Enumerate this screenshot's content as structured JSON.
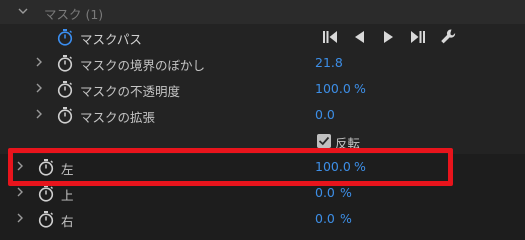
{
  "header": {
    "label": "マスク (1)"
  },
  "mask_path": {
    "label": "マスクパス"
  },
  "props": [
    {
      "label": "マスクの境界のぼかし",
      "value": "21.8",
      "unit": ""
    },
    {
      "label": "マスクの不透明度",
      "value": "100.0",
      "unit": "%"
    },
    {
      "label": "マスクの拡張",
      "value": "0.0",
      "unit": ""
    }
  ],
  "invert": {
    "label": "反転",
    "checked": true
  },
  "crop": [
    {
      "label": "左",
      "value": "100.0",
      "unit": "%"
    },
    {
      "label": "上",
      "value": "0.0",
      "unit": "%"
    },
    {
      "label": "右",
      "value": "0.0",
      "unit": "%"
    }
  ],
  "colors": {
    "panel_bg": "#1d1d1d",
    "header_bg": "#2b2b2b",
    "row_bg": "#232323",
    "value_blue": "#3d8ee6",
    "highlight_red": "#e8141c"
  },
  "icons": [
    "chevron-down-icon",
    "chevron-right-icon",
    "stopwatch-icon",
    "track-backward-icon",
    "step-backward-icon",
    "step-forward-icon",
    "track-forward-icon",
    "wrench-icon",
    "checkbox-icon"
  ]
}
